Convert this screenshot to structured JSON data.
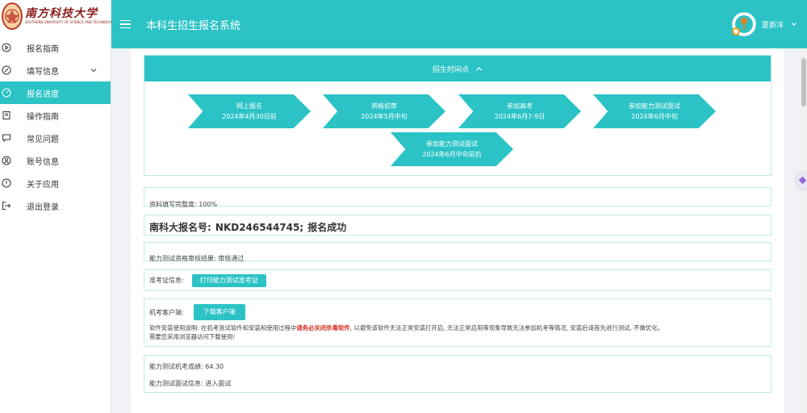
{
  "logo": {
    "name_cn": "南方科技大学",
    "name_en": "SOUTHERN UNIVERSITY OF SCIENCE AND TECHNOLOGY"
  },
  "sidebar": {
    "items": [
      {
        "label": "报名指南",
        "icon": "play-circle-icon",
        "active": false
      },
      {
        "label": "填写信息",
        "icon": "edit-icon",
        "active": false,
        "has_submenu": true
      },
      {
        "label": "报名进度",
        "icon": "gauge-icon",
        "active": true
      },
      {
        "label": "操作指南",
        "icon": "book-icon",
        "active": false
      },
      {
        "label": "常见问题",
        "icon": "chat-icon",
        "active": false
      },
      {
        "label": "账号信息",
        "icon": "user-icon",
        "active": false
      },
      {
        "label": "关于应用",
        "icon": "info-icon",
        "active": false
      },
      {
        "label": "退出登录",
        "icon": "logout-icon",
        "active": false
      }
    ]
  },
  "header": {
    "title": "本科生招生报名系统",
    "user_name": "夏新洋"
  },
  "timeline": {
    "title": "招生时间点",
    "steps": [
      {
        "name": "网上报名",
        "date": "2024年4月30日前"
      },
      {
        "name": "资格初审",
        "date": "2024年5月中旬"
      },
      {
        "name": "参加高考",
        "date": "2024年6月7-9日"
      },
      {
        "name": "参加能力测试面试",
        "date": "2024年6月中旬"
      },
      {
        "name": "参加能力测试面试",
        "date": "2024年6月中旬前后"
      }
    ]
  },
  "progress": {
    "completion_text": "资料填写完整度: 100%"
  },
  "registration": {
    "label": "南科大报名号:",
    "number": "NKD246544745",
    "status": "报名成功"
  },
  "review": {
    "text": "能力测试资格审核结果: 审核通过"
  },
  "admit_card": {
    "label": "准考证信息:",
    "button": "打印能力测试准考证"
  },
  "exam_client": {
    "label": "机考客户端:",
    "button": "下载客户端",
    "notice_prefix": "软件安装使用说明: 在机考测试软件和安装和使用过程中",
    "notice_red": "请务必关闭杀毒软件",
    "notice_suffix": ", 以避免该软件无法正常安装打开启, 无法正常启用等现象导致无法参加机考等情况, 安装后请首先进行测试, 不做优化。",
    "notice_line2": "需要您采用浏览器访问下载使用!"
  },
  "result": {
    "score_text": "能力测试机考成绩: 64.30",
    "interview_text": "能力测试面试信息: 进入面试"
  }
}
